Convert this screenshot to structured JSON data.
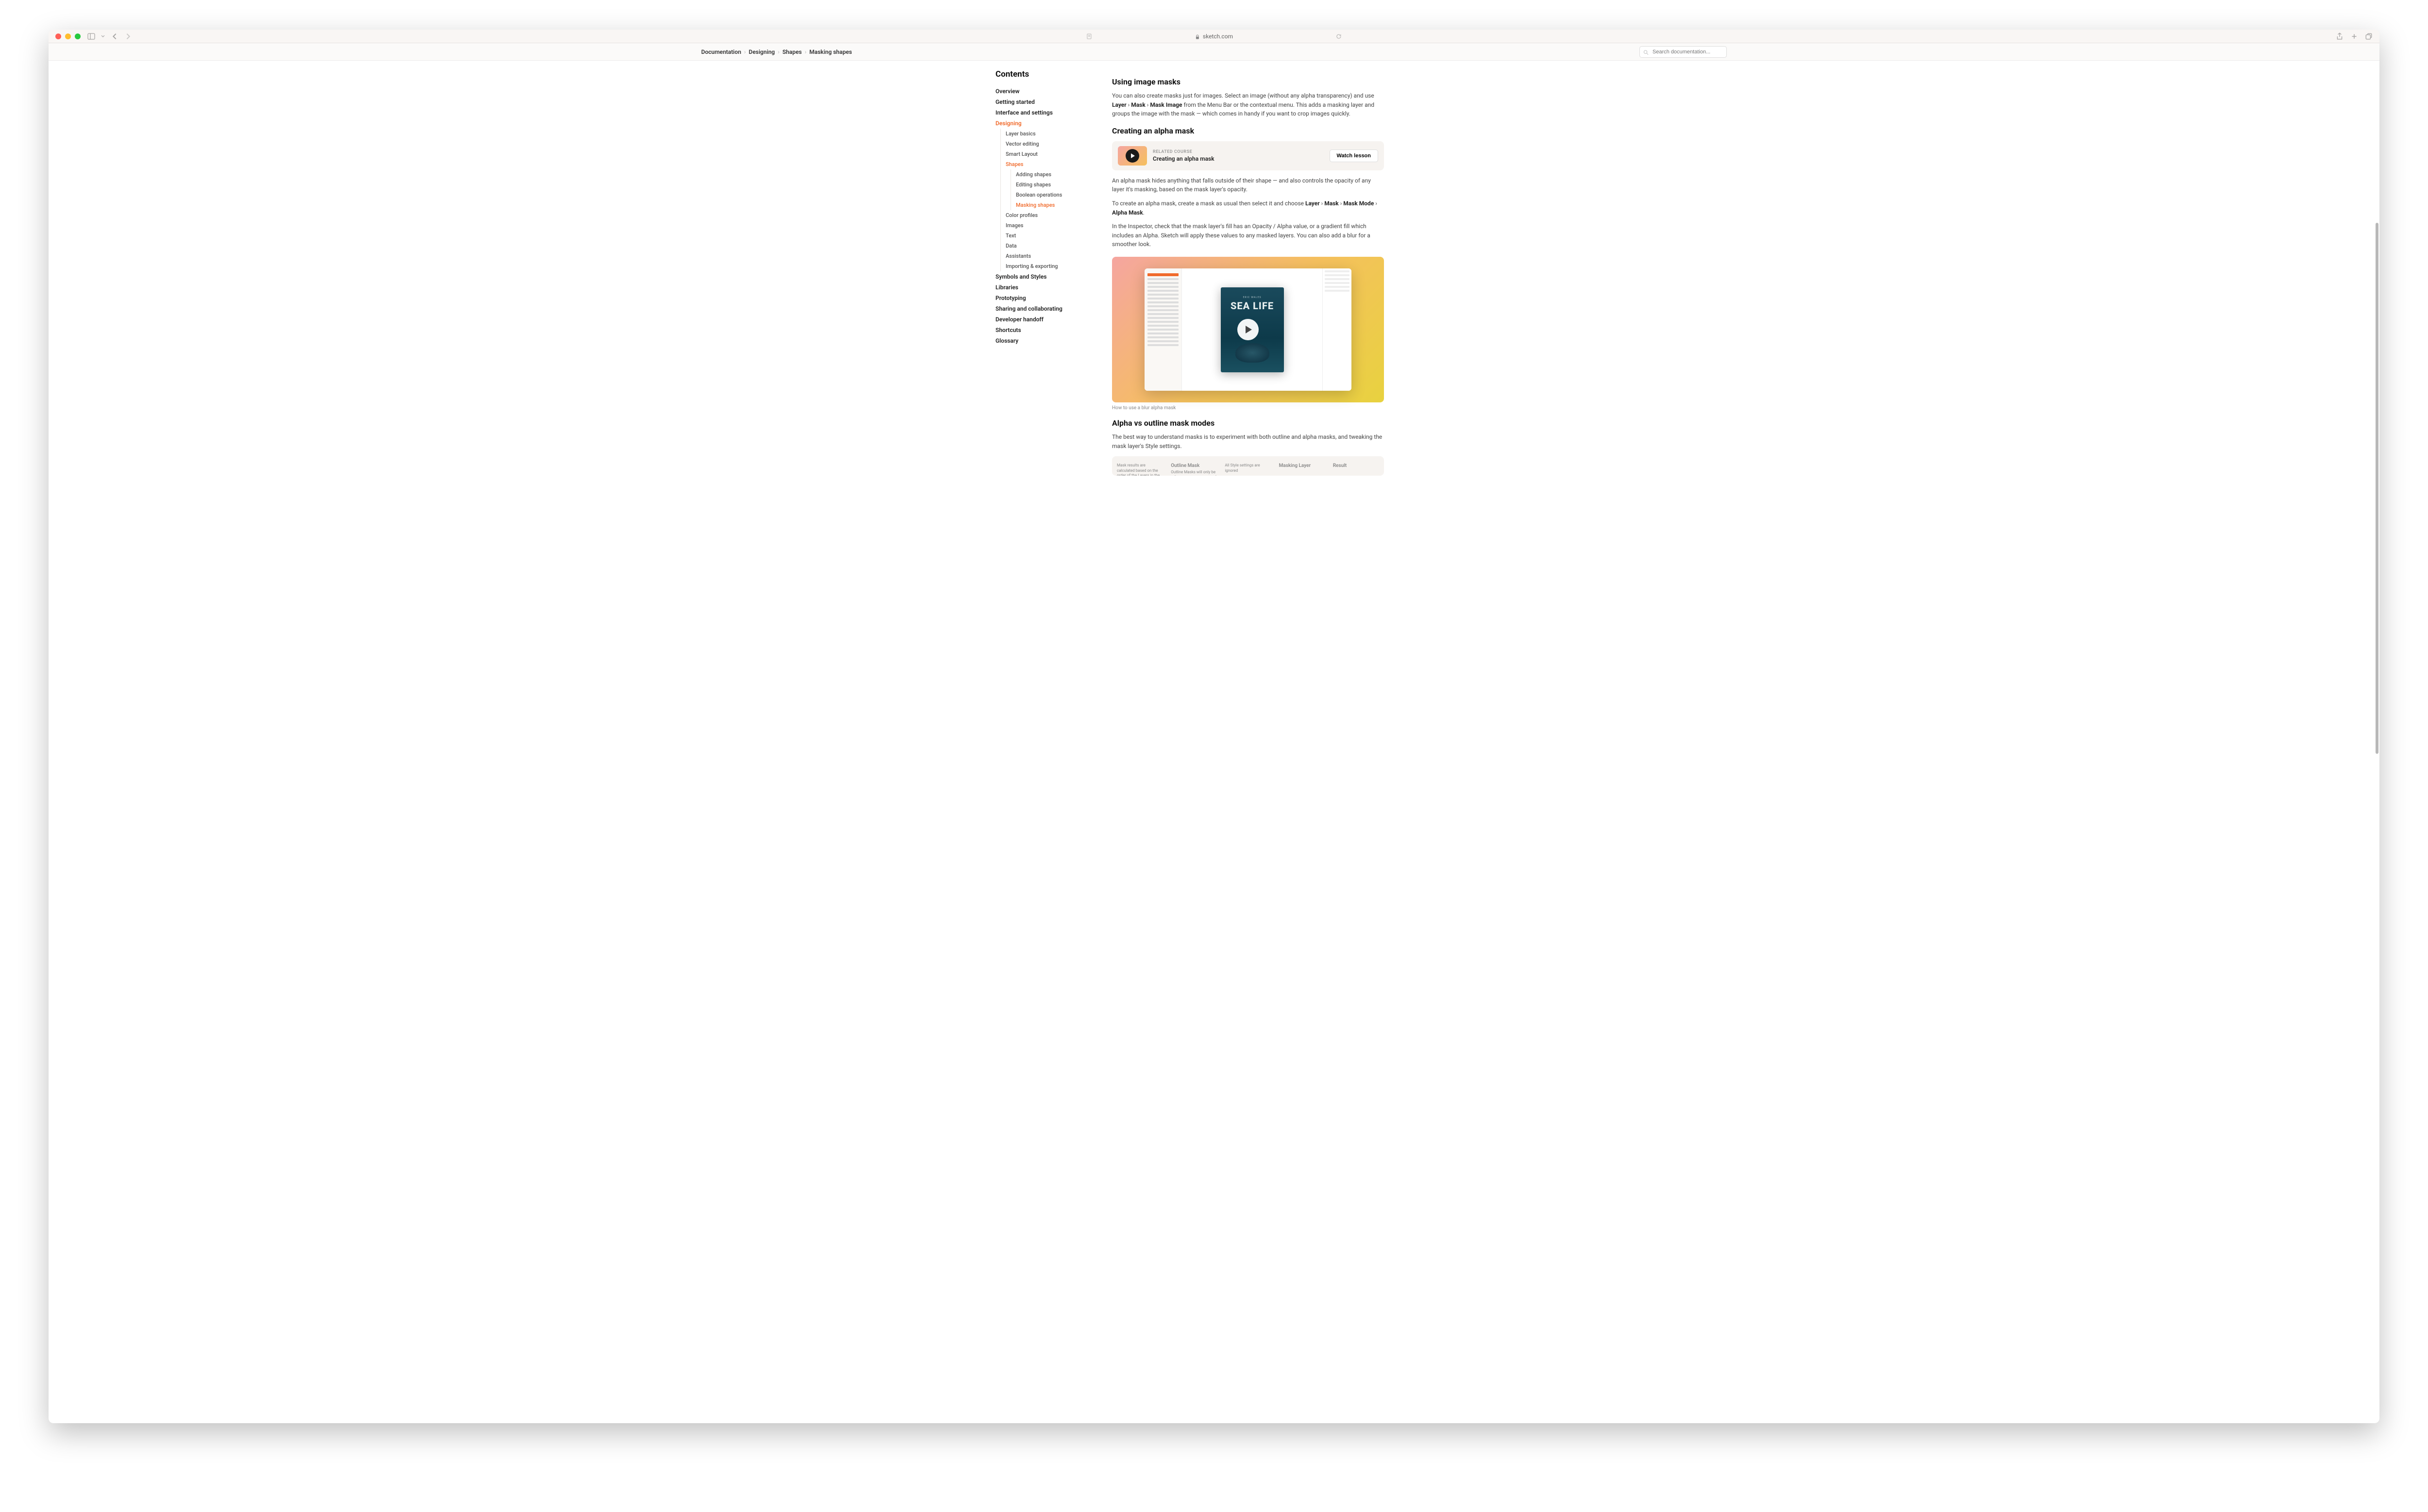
{
  "titlebar": {
    "url": "sketch.com"
  },
  "breadcrumb": [
    "Documentation",
    "Designing",
    "Shapes",
    "Masking shapes"
  ],
  "search": {
    "placeholder": "Search documentation..."
  },
  "sidebar": {
    "title": "Contents",
    "top": [
      "Overview",
      "Getting started",
      "Interface and settings"
    ],
    "designing": "Designing",
    "designing_items": [
      "Layer basics",
      "Vector editing",
      "Smart Layout"
    ],
    "shapes": "Shapes",
    "shapes_items": [
      "Adding shapes",
      "Editing shapes",
      "Boolean operations",
      "Masking shapes"
    ],
    "designing_after": [
      "Color profiles",
      "Images",
      "Text",
      "Data",
      "Assistants",
      "Importing & exporting"
    ],
    "bottom": [
      "Symbols and Styles",
      "Libraries",
      "Prototyping",
      "Sharing and collaborating",
      "Developer handoff",
      "Shortcuts",
      "Glossary"
    ]
  },
  "main": {
    "h1": "Using image masks",
    "p1a": "You can also create masks just for images. Select an image (without any alpha transparency) and use ",
    "p1b": " from the Menu Bar or the contextual menu. This adds a masking layer and groups the image with the mask — which comes in handy if you want to crop images quickly.",
    "menu1": [
      "Layer",
      "Mask",
      "Mask Image"
    ],
    "h2": "Creating an alpha mask",
    "card": {
      "label": "RELATED COURSE",
      "title": "Creating an alpha mask",
      "button": "Watch lesson"
    },
    "p2": "An alpha mask hides anything that falls outside of their shape — and also controls the opacity of any layer it's masking, based on the mask layer's opacity.",
    "p3a": "To create an alpha mask, create a mask as usual then select it and choose ",
    "menu2": [
      "Layer",
      "Mask",
      "Mask Mode",
      "Alpha Mask"
    ],
    "p4": "In the Inspector, check that the mask layer's fill has an Opacity / Alpha value, or a gradient fill which includes an Alpha. Sketch will apply these values to any masked layers. You can also add a blur for a smoother look.",
    "book": {
      "author": "ERIC WALES",
      "title": "SEA LIFE"
    },
    "caption": "How to use a blur alpha mask",
    "h3": "Alpha vs outline mask modes",
    "p5": "The best way to understand masks is to experiment with both outline and alpha masks, and tweaking the mask layer's Style settings.",
    "infographic": {
      "colA": "Mask results are calculated based on the order of the Layers in the Layer list, the type of mask",
      "colB_title": "Outline Mask",
      "colB": "Outline Masks will only be influenced by the shape of",
      "colC": "All Style settings are ignored",
      "colD_title": "Masking Layer",
      "colE_title": "Result"
    }
  }
}
